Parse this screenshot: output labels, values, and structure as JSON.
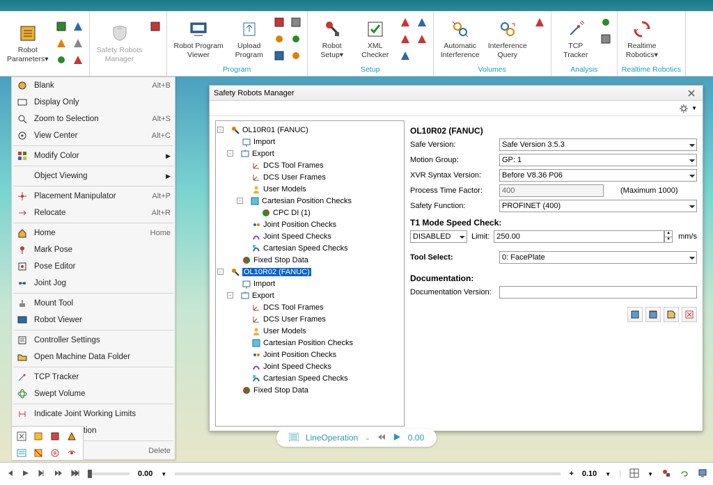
{
  "ribbon": {
    "groups": [
      {
        "label": "",
        "buttons": [
          {
            "label": "Robot\nParameters▾",
            "icon": "settings"
          }
        ],
        "smallcols": [
          [
            "robot-icon",
            "link-icon",
            "box-icon"
          ],
          [
            "arrow-icon",
            "hand-icon",
            "cube-icon"
          ]
        ]
      },
      {
        "label": "",
        "labelGray": true,
        "buttons": [
          {
            "label": "Safety Robots\nManager",
            "icon": "shield",
            "disabled": true
          }
        ],
        "smallcols": [
          [
            "shield-icon",
            "",
            ""
          ]
        ]
      },
      {
        "label": "Program",
        "buttons": [
          {
            "label": "Robot Program\nViewer",
            "icon": "monitor"
          },
          {
            "label": "Upload\nProgram",
            "icon": "upload"
          }
        ],
        "smallcols": [
          [
            "doc-icon",
            "gear-icon",
            "swap-icon"
          ],
          [
            "up-icon",
            "db-icon",
            "note-icon"
          ]
        ]
      },
      {
        "label": "Setup",
        "buttons": [
          {
            "label": "Robot\nSetup▾",
            "icon": "robot-red"
          },
          {
            "label": "XML\nChecker",
            "icon": "check"
          }
        ],
        "smallcols": [
          [
            "sq-icon",
            "cal-icon",
            "bolt-icon"
          ],
          [
            "chart-icon",
            "hand2-icon",
            ""
          ]
        ]
      },
      {
        "label": "Volumes",
        "buttons": [
          {
            "label": "Automatic\nInterference",
            "icon": "auto"
          },
          {
            "label": "Interference\nQuery",
            "icon": "query"
          }
        ],
        "smallcols": [
          [
            "v-icon",
            "",
            ""
          ]
        ]
      },
      {
        "label": "Analysis",
        "buttons": [
          {
            "label": "TCP\nTracker",
            "icon": "tcp"
          }
        ],
        "smallcols": [
          [
            "dot-icon",
            "ball-icon",
            ""
          ]
        ]
      },
      {
        "label": "Realtime Robotics",
        "buttons": [
          {
            "label": "Realtime\nRobotics▾",
            "icon": "rr"
          }
        ]
      }
    ]
  },
  "context_menu": [
    {
      "type": "item",
      "label": "Blank",
      "shortcut": "Alt+B",
      "icon": "blank"
    },
    {
      "type": "item",
      "label": "Display Only",
      "shortcut": "",
      "icon": "display"
    },
    {
      "type": "item",
      "label": "Zoom to Selection",
      "shortcut": "Alt+S",
      "icon": "zoom"
    },
    {
      "type": "item",
      "label": "View Center",
      "shortcut": "Alt+C",
      "icon": "center"
    },
    {
      "type": "sep"
    },
    {
      "type": "item",
      "label": "Modify Color",
      "shortcut": "",
      "icon": "color",
      "sub": true
    },
    {
      "type": "sep"
    },
    {
      "type": "item",
      "label": "Object Viewing",
      "shortcut": "",
      "icon": "",
      "sub": true
    },
    {
      "type": "sep"
    },
    {
      "type": "item",
      "label": "Placement Manipulator",
      "shortcut": "Alt+P",
      "icon": "placement"
    },
    {
      "type": "item",
      "label": "Relocate",
      "shortcut": "Alt+R",
      "icon": "relocate"
    },
    {
      "type": "sep"
    },
    {
      "type": "item",
      "label": "Home",
      "shortcut": "Home",
      "icon": "home"
    },
    {
      "type": "item",
      "label": "Mark Pose",
      "shortcut": "",
      "icon": "mark"
    },
    {
      "type": "item",
      "label": "Pose Editor",
      "shortcut": "",
      "icon": "pose"
    },
    {
      "type": "item",
      "label": "Joint Jog",
      "shortcut": "",
      "icon": "jog"
    },
    {
      "type": "sep"
    },
    {
      "type": "item",
      "label": "Mount Tool",
      "shortcut": "",
      "icon": "mount"
    },
    {
      "type": "item",
      "label": "Robot Viewer",
      "shortcut": "",
      "icon": "viewer"
    },
    {
      "type": "sep"
    },
    {
      "type": "item",
      "label": "Controller Settings",
      "shortcut": "",
      "icon": "ctrl"
    },
    {
      "type": "item",
      "label": "Open Machine Data Folder",
      "shortcut": "",
      "icon": "folder"
    },
    {
      "type": "sep"
    },
    {
      "type": "item",
      "label": "TCP Tracker",
      "shortcut": "",
      "icon": "tcp"
    },
    {
      "type": "item",
      "label": "Swept Volume",
      "shortcut": "",
      "icon": "swept"
    },
    {
      "type": "sep"
    },
    {
      "type": "item",
      "label": "Indicate Joint Working Limits",
      "shortcut": "",
      "icon": "limits"
    },
    {
      "type": "item",
      "label": "Limit Joint Motion",
      "shortcut": "",
      "icon": "limit"
    },
    {
      "type": "sep"
    },
    {
      "type": "item",
      "label": "Delete",
      "shortcut": "Delete",
      "icon": "delete"
    }
  ],
  "dialog": {
    "title": "Safety Robots Manager",
    "tree": [
      {
        "d": 0,
        "exp": "-",
        "label": "OL10R01 (FANUC)",
        "icon": "robot"
      },
      {
        "d": 1,
        "exp": "",
        "label": "Import",
        "icon": "import"
      },
      {
        "d": 1,
        "exp": "-",
        "label": "Export",
        "icon": "export"
      },
      {
        "d": 2,
        "exp": "",
        "label": "DCS Tool Frames",
        "icon": "axes"
      },
      {
        "d": 2,
        "exp": "",
        "label": "DCS User Frames",
        "icon": "axes"
      },
      {
        "d": 2,
        "exp": "",
        "label": "User Models",
        "icon": "user"
      },
      {
        "d": 2,
        "exp": "-",
        "label": "Cartesian Position Checks",
        "icon": "cpc"
      },
      {
        "d": 3,
        "exp": "",
        "label": "CPC DI (1)",
        "icon": "pie"
      },
      {
        "d": 2,
        "exp": "",
        "label": "Joint Position Checks",
        "icon": "jpc"
      },
      {
        "d": 2,
        "exp": "",
        "label": "Joint Speed Checks",
        "icon": "jsc"
      },
      {
        "d": 2,
        "exp": "",
        "label": "Cartesian Speed Checks",
        "icon": "csc"
      },
      {
        "d": 1,
        "exp": "",
        "label": "Fixed Stop Data",
        "icon": "stop"
      },
      {
        "d": 0,
        "exp": "-",
        "label": "OL10R02 (FANUC)",
        "icon": "robot",
        "selected": true
      },
      {
        "d": 1,
        "exp": "",
        "label": "Import",
        "icon": "import"
      },
      {
        "d": 1,
        "exp": "-",
        "label": "Export",
        "icon": "export"
      },
      {
        "d": 2,
        "exp": "",
        "label": "DCS Tool Frames",
        "icon": "axes"
      },
      {
        "d": 2,
        "exp": "",
        "label": "DCS User Frames",
        "icon": "axes"
      },
      {
        "d": 2,
        "exp": "",
        "label": "User Models",
        "icon": "user"
      },
      {
        "d": 2,
        "exp": "",
        "label": "Cartesian Position Checks",
        "icon": "cpc"
      },
      {
        "d": 2,
        "exp": "",
        "label": "Joint Position Checks",
        "icon": "jpc"
      },
      {
        "d": 2,
        "exp": "",
        "label": "Joint Speed Checks",
        "icon": "jsc"
      },
      {
        "d": 2,
        "exp": "",
        "label": "Cartesian Speed Checks",
        "icon": "csc"
      },
      {
        "d": 1,
        "exp": "",
        "label": "Fixed Stop Data",
        "icon": "stop"
      }
    ],
    "props": {
      "heading": "OL10R02 (FANUC)",
      "safe_version_label": "Safe Version:",
      "safe_version": "Safe Version 3.5.3",
      "motion_group_label": "Motion Group:",
      "motion_group": "GP: 1",
      "xvr_label": "XVR Syntax Version:",
      "xvr": "Before V8.36 P06",
      "ptf_label": "Process Time Factor:",
      "ptf": "400",
      "ptf_note": "(Maximum 1000)",
      "safety_fn_label": "Safety Function:",
      "safety_fn": "PROFINET (400)",
      "t1_header": "T1 Mode Speed Check:",
      "t1_mode": "DISABLED",
      "t1_limit_label": "Limit:",
      "t1_limit": "250.00",
      "t1_unit": "mm/s",
      "tool_header": "Tool Select:",
      "tool": "0: FacePlate",
      "doc_header": "Documentation:",
      "doc_ver_label": "Documentation Version:",
      "doc_ver": ""
    }
  },
  "play_pill": {
    "label": "LineOperation",
    "time": "0.00"
  },
  "status": {
    "time_left": "0.00",
    "time_right": "0.10"
  }
}
